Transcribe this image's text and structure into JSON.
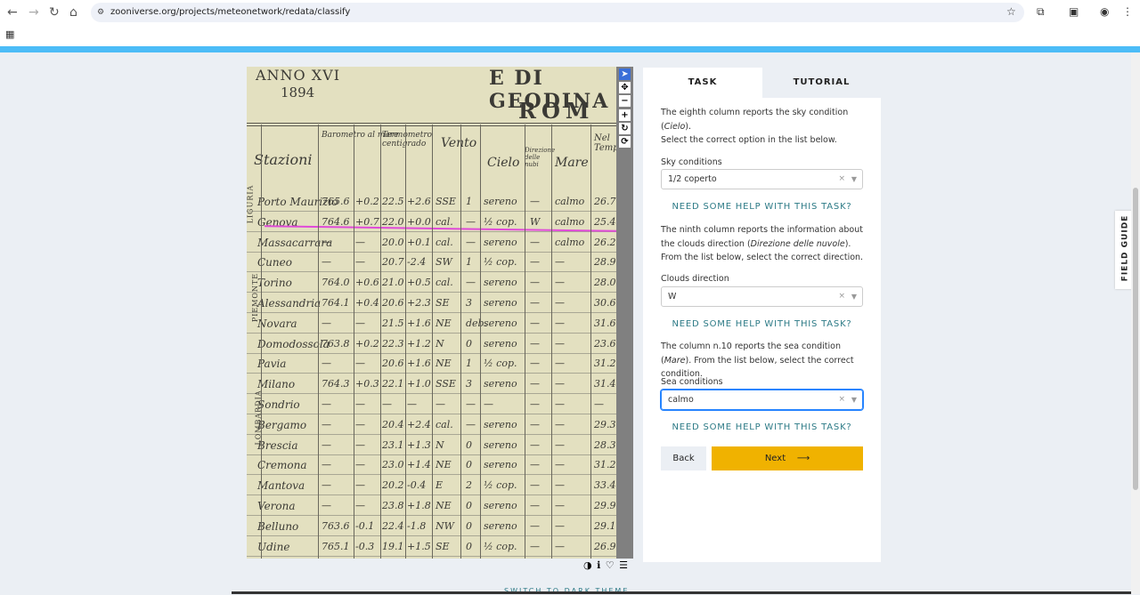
{
  "browser": {
    "url": "zooniverse.org/projects/meteonetwork/redata/classify"
  },
  "subject": {
    "header": [
      "ANNO XVI",
      "1894",
      "E DI GEODINA",
      "ROM"
    ],
    "columns": [
      "Stazioni",
      "Barometro al mare",
      "Termometro centigrado",
      "Vento",
      "Cielo",
      "Direzione delle nubi",
      "Mare",
      "Nel Temp."
    ],
    "regions": [
      "LIGURIA",
      "PIEMONTE",
      "LOMBARDIA"
    ],
    "rows": [
      {
        "station": "Porto Maurizio",
        "baro": "765.6",
        "bd": "+0.2",
        "temp": "22.5",
        "td": "+2.6",
        "vento": "SSE",
        "v": "1",
        "cielo": "sereno",
        "nubi": "—",
        "mare": "calmo",
        "t": "26.7"
      },
      {
        "station": "Genova",
        "baro": "764.6",
        "bd": "+0.7",
        "temp": "22.0",
        "td": "+0.0",
        "vento": "cal.",
        "v": "—",
        "cielo": "½ cop.",
        "nubi": "W",
        "mare": "calmo",
        "t": "25.4"
      },
      {
        "station": "Massacarrara",
        "baro": "—",
        "bd": "—",
        "temp": "20.0",
        "td": "+0.1",
        "vento": "cal.",
        "v": "—",
        "cielo": "sereno",
        "nubi": "—",
        "mare": "calmo",
        "t": "26.2"
      },
      {
        "station": "Cuneo",
        "baro": "—",
        "bd": "—",
        "temp": "20.7",
        "td": "-2.4",
        "vento": "SW",
        "v": "1",
        "cielo": "½ cop.",
        "nubi": "—",
        "mare": "—",
        "t": "28.9"
      },
      {
        "station": "Torino",
        "baro": "764.0",
        "bd": "+0.6",
        "temp": "21.0",
        "td": "+0.5",
        "vento": "cal.",
        "v": "—",
        "cielo": "sereno",
        "nubi": "—",
        "mare": "—",
        "t": "28.0"
      },
      {
        "station": "Alessandria",
        "baro": "764.1",
        "bd": "+0.4",
        "temp": "20.6",
        "td": "+2.3",
        "vento": "SE",
        "v": "3",
        "cielo": "sereno",
        "nubi": "—",
        "mare": "—",
        "t": "30.6"
      },
      {
        "station": "Novara",
        "baro": "—",
        "bd": "—",
        "temp": "21.5",
        "td": "+1.6",
        "vento": "NE",
        "v": "deb.",
        "cielo": "sereno",
        "nubi": "—",
        "mare": "—",
        "t": "31.6"
      },
      {
        "station": "Domodossola",
        "baro": "763.8",
        "bd": "+0.2",
        "temp": "22.3",
        "td": "+1.2",
        "vento": "N",
        "v": "0",
        "cielo": "sereno",
        "nubi": "—",
        "mare": "—",
        "t": "23.6"
      },
      {
        "station": "Pavia",
        "baro": "—",
        "bd": "—",
        "temp": "20.6",
        "td": "+1.6",
        "vento": "NE",
        "v": "1",
        "cielo": "½ cop.",
        "nubi": "—",
        "mare": "—",
        "t": "31.2"
      },
      {
        "station": "Milano",
        "baro": "764.3",
        "bd": "+0.3",
        "temp": "22.1",
        "td": "+1.0",
        "vento": "SSE",
        "v": "3",
        "cielo": "sereno",
        "nubi": "—",
        "mare": "—",
        "t": "31.4"
      },
      {
        "station": "Sondrio",
        "baro": "—",
        "bd": "—",
        "temp": "—",
        "td": "—",
        "vento": "—",
        "v": "—",
        "cielo": "—",
        "nubi": "—",
        "mare": "—",
        "t": "—"
      },
      {
        "station": "Bergamo",
        "baro": "—",
        "bd": "—",
        "temp": "20.4",
        "td": "+2.4",
        "vento": "cal.",
        "v": "—",
        "cielo": "sereno",
        "nubi": "—",
        "mare": "—",
        "t": "29.3"
      },
      {
        "station": "Brescia",
        "baro": "—",
        "bd": "—",
        "temp": "23.1",
        "td": "+1.3",
        "vento": "N",
        "v": "0",
        "cielo": "sereno",
        "nubi": "—",
        "mare": "—",
        "t": "28.3"
      },
      {
        "station": "Cremona",
        "baro": "—",
        "bd": "—",
        "temp": "23.0",
        "td": "+1.4",
        "vento": "NE",
        "v": "0",
        "cielo": "sereno",
        "nubi": "—",
        "mare": "—",
        "t": "31.2"
      },
      {
        "station": "Mantova",
        "baro": "—",
        "bd": "—",
        "temp": "20.2",
        "td": "-0.4",
        "vento": "E",
        "v": "2",
        "cielo": "½ cop.",
        "nubi": "—",
        "mare": "—",
        "t": "33.4"
      },
      {
        "station": "Verona",
        "baro": "—",
        "bd": "—",
        "temp": "23.8",
        "td": "+1.8",
        "vento": "NE",
        "v": "0",
        "cielo": "sereno",
        "nubi": "—",
        "mare": "—",
        "t": "29.9"
      },
      {
        "station": "Belluno",
        "baro": "763.6",
        "bd": "-0.1",
        "temp": "22.4",
        "td": "-1.8",
        "vento": "NW",
        "v": "0",
        "cielo": "sereno",
        "nubi": "—",
        "mare": "—",
        "t": "29.1"
      },
      {
        "station": "Udine",
        "baro": "765.1",
        "bd": "-0.3",
        "temp": "19.1",
        "td": "+1.5",
        "vento": "SE",
        "v": "0",
        "cielo": "½ cop.",
        "nubi": "—",
        "mare": "—",
        "t": "26.9"
      }
    ]
  },
  "tools": [
    {
      "icon": "pointer-icon",
      "glyph": "➤"
    },
    {
      "icon": "move-icon",
      "glyph": "✥"
    },
    {
      "icon": "zoom-out-icon",
      "glyph": "−"
    },
    {
      "icon": "zoom-in-icon",
      "glyph": "+"
    },
    {
      "icon": "rotate-icon",
      "glyph": "↻"
    },
    {
      "icon": "reset-icon",
      "glyph": "⟳"
    }
  ],
  "image_toolbar": {
    "contrast": "◑",
    "info": "ℹ",
    "favorite": "♡",
    "collections": "☰"
  },
  "tabs": {
    "task": "TASK",
    "tutorial": "TUTORIAL"
  },
  "task": {
    "q1_a": "The eighth column reports the sky condition (",
    "q1_em": "Cielo",
    "q1_b": ").",
    "q1_c": "Select the correct option in the list below.",
    "label1": "Sky conditions",
    "value1": "1/2 coperto",
    "help": "NEED SOME HELP WITH THIS TASK?",
    "q2_a": "The ninth column reports the information about the clouds direction (",
    "q2_em": "Direzione delle nuvole",
    "q2_b": "). From the list below, select the correct direction.",
    "label2": "Clouds direction",
    "value2": "W",
    "q3_a": "The column n.10 reports the sea condition (",
    "q3_em": "Mare",
    "q3_b": "). From the list below, select the correct condition.",
    "label3": "Sea conditions",
    "value3": "calmo",
    "back": "Back",
    "next": "Next",
    "next_arrow": "⟶"
  },
  "field_guide": "FIELD GUIDE",
  "footer": {
    "dark_theme": "SWITCH TO DARK THEME"
  },
  "colors": {
    "accent": "#f0b200",
    "link": "#2c7a86",
    "topbar": "#4cbcf7"
  }
}
